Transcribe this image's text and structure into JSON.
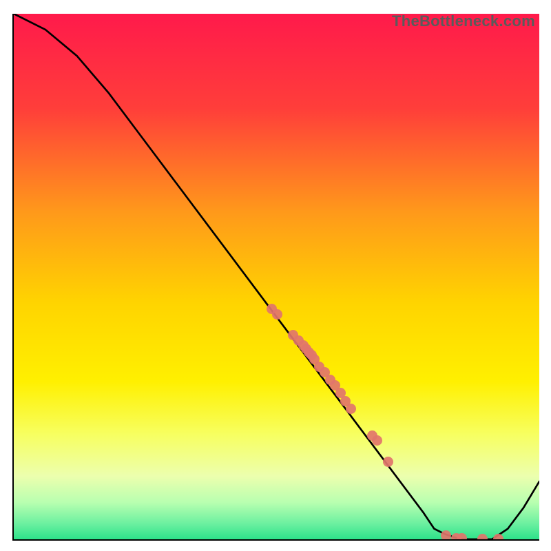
{
  "watermark": "TheBottleneck.com",
  "colors": {
    "bg_top": "#ff1a4b",
    "bg_mid1": "#ff7a1f",
    "bg_mid2": "#ffe000",
    "bg_low1": "#f5ff66",
    "bg_low2": "#b8ff9e",
    "bg_bottom": "#2de28a",
    "curve": "#000000",
    "dot": "#e1756b"
  },
  "chart_data": {
    "type": "line",
    "title": "",
    "xlabel": "",
    "ylabel": "",
    "xlim": [
      0,
      100
    ],
    "ylim": [
      0,
      100
    ],
    "grid": false,
    "legend": false,
    "series": [
      {
        "name": "curve",
        "x": [
          0,
          6,
          12,
          18,
          24,
          30,
          36,
          42,
          48,
          54,
          60,
          66,
          72,
          78,
          80,
          82,
          85,
          88,
          91,
          94,
          97,
          100
        ],
        "y": [
          100,
          97,
          92,
          85,
          77,
          69,
          61,
          53,
          45,
          37,
          29,
          21,
          13,
          5,
          2,
          1,
          0,
          0,
          0,
          2,
          6,
          11
        ]
      },
      {
        "name": "scatter_points",
        "x": [
          49,
          50,
          53,
          54,
          55,
          55.5,
          56,
          56.5,
          57,
          58,
          59,
          60,
          61,
          62,
          63,
          64,
          68,
          69,
          71,
          82,
          84,
          85,
          89,
          92
        ],
        "y": [
          44,
          43,
          39,
          38,
          37,
          36.4,
          35.8,
          35.2,
          34.5,
          33,
          32,
          30.5,
          29.5,
          28,
          26.5,
          25,
          20,
          19,
          15,
          1,
          0.5,
          0.5,
          0.3,
          0.3
        ]
      }
    ]
  }
}
